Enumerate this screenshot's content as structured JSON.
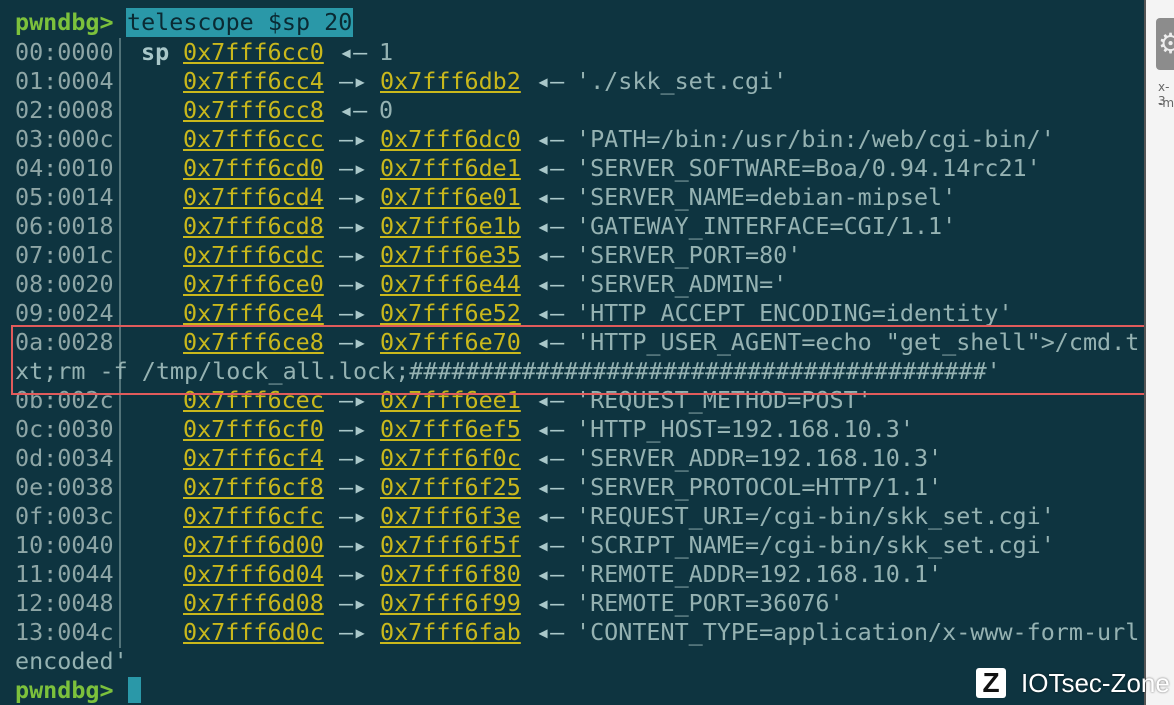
{
  "terminal": {
    "prompt": "pwndbg>",
    "command": "telescope $sp 20",
    "sp_label": "sp",
    "arrow_left": "◂—",
    "arrow_right": "—▸",
    "rows": [
      {
        "off": "00:0000",
        "addr": "0x7fff6cc0",
        "target": "",
        "value": "1"
      },
      {
        "off": "01:0004",
        "addr": "0x7fff6cc4",
        "target": "0x7fff6db2",
        "value": "'./skk_set.cgi'"
      },
      {
        "off": "02:0008",
        "addr": "0x7fff6cc8",
        "target": "",
        "value": "0"
      },
      {
        "off": "03:000c",
        "addr": "0x7fff6ccc",
        "target": "0x7fff6dc0",
        "value": "'PATH=/bin:/usr/bin:/web/cgi-bin/'"
      },
      {
        "off": "04:0010",
        "addr": "0x7fff6cd0",
        "target": "0x7fff6de1",
        "value": "'SERVER_SOFTWARE=Boa/0.94.14rc21'"
      },
      {
        "off": "05:0014",
        "addr": "0x7fff6cd4",
        "target": "0x7fff6e01",
        "value": "'SERVER_NAME=debian-mipsel'"
      },
      {
        "off": "06:0018",
        "addr": "0x7fff6cd8",
        "target": "0x7fff6e1b",
        "value": "'GATEWAY_INTERFACE=CGI/1.1'"
      },
      {
        "off": "07:001c",
        "addr": "0x7fff6cdc",
        "target": "0x7fff6e35",
        "value": "'SERVER_PORT=80'"
      },
      {
        "off": "08:0020",
        "addr": "0x7fff6ce0",
        "target": "0x7fff6e44",
        "value": "'SERVER_ADMIN='"
      },
      {
        "off": "09:0024",
        "addr": "0x7fff6ce4",
        "target": "0x7fff6e52",
        "value": "'HTTP_ACCEPT_ENCODING=identity'"
      },
      {
        "off": "0a:0028",
        "addr": "0x7fff6ce8",
        "target": "0x7fff6e70",
        "value": "'HTTP_USER_AGENT=echo \"get_shell\">/cmd.t",
        "wrap": "xt;rm -f /tmp/lock_all.lock;#########################################'"
      },
      {
        "off": "0b:002c",
        "addr": "0x7fff6cec",
        "target": "0x7fff6ee1",
        "value": "'REQUEST_METHOD=POST'"
      },
      {
        "off": "0c:0030",
        "addr": "0x7fff6cf0",
        "target": "0x7fff6ef5",
        "value": "'HTTP_HOST=192.168.10.3'"
      },
      {
        "off": "0d:0034",
        "addr": "0x7fff6cf4",
        "target": "0x7fff6f0c",
        "value": "'SERVER_ADDR=192.168.10.3'"
      },
      {
        "off": "0e:0038",
        "addr": "0x7fff6cf8",
        "target": "0x7fff6f25",
        "value": "'SERVER_PROTOCOL=HTTP/1.1'"
      },
      {
        "off": "0f:003c",
        "addr": "0x7fff6cfc",
        "target": "0x7fff6f3e",
        "value": "'REQUEST_URI=/cgi-bin/skk_set.cgi'"
      },
      {
        "off": "10:0040",
        "addr": "0x7fff6d00",
        "target": "0x7fff6f5f",
        "value": "'SCRIPT_NAME=/cgi-bin/skk_set.cgi'"
      },
      {
        "off": "11:0044",
        "addr": "0x7fff6d04",
        "target": "0x7fff6f80",
        "value": "'REMOTE_ADDR=192.168.10.1'"
      },
      {
        "off": "12:0048",
        "addr": "0x7fff6d08",
        "target": "0x7fff6f99",
        "value": "'REMOTE_PORT=36076'"
      },
      {
        "off": "13:004c",
        "addr": "0x7fff6d0c",
        "target": "0x7fff6fab",
        "value": "'CONTENT_TYPE=application/x-www-form-url",
        "wrap": "encoded'"
      }
    ]
  },
  "sidebar": {
    "text1": "x-3",
    "text2": "-m"
  },
  "watermark": {
    "logo": "Z",
    "text": "IOTsec-Zone"
  },
  "colors": {
    "background": "#0e3440",
    "prompt": "#7cc13c",
    "address": "#c9b81c",
    "highlight_box": "#e15b5b",
    "command_bg": "#2a98a8"
  }
}
